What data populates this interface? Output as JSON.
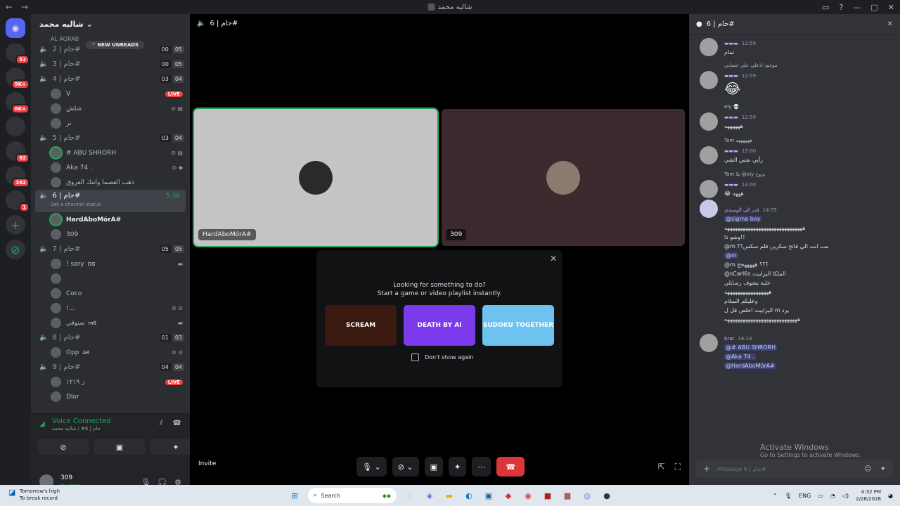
{
  "window": {
    "title": "شاليه محمد"
  },
  "rail": {
    "servers": [
      {
        "icon": "discord-home-icon",
        "badge": ""
      },
      {
        "icon": "server-icon",
        "badge": "52"
      },
      {
        "icon": "server-icon",
        "badge": "9K+"
      },
      {
        "icon": "server-icon",
        "badge": "6K+"
      },
      {
        "icon": "server-icon",
        "badge": ""
      },
      {
        "icon": "server-icon",
        "badge": "92"
      },
      {
        "icon": "server-icon",
        "badge": "382"
      },
      {
        "icon": "server-icon",
        "badge": "1"
      }
    ]
  },
  "server": {
    "name": "شاليه محمد",
    "new_unreads": "NEW UNREADS"
  },
  "channels": {
    "top_cut": "AL AQRAB",
    "c2": {
      "name": "حام | 2#",
      "n1": "00",
      "n2": "05"
    },
    "c3": {
      "name": "حام | 3#",
      "n1": "00",
      "n2": "05"
    },
    "c4": {
      "name": "حام | 4#",
      "n1": "03",
      "n2": "04"
    },
    "c4_users": [
      {
        "name": "V",
        "live": "LIVE"
      },
      {
        "name": "شلش"
      },
      {
        "name": "نر"
      }
    ],
    "c5": {
      "name": "حام | 5#",
      "n1": "03",
      "n2": "04"
    },
    "c5_users": [
      {
        "name": "# ABU SHRORH"
      },
      {
        "name": "Aka 74 ."
      },
      {
        "name": "ذهب العصما وانتك العروق"
      }
    ],
    "c6": {
      "name": "حام | 6#",
      "timer": "5:36",
      "status": "Set a channel status"
    },
    "c6_users": [
      {
        "name": "HardAboMórA#"
      },
      {
        "name": "309"
      }
    ],
    "c7": {
      "name": "حام | 7#",
      "n1": "05",
      "n2": "05"
    },
    "c7_users": [
      {
        "name": "! sary",
        "tag": "DG"
      },
      {
        "name": "."
      },
      {
        "name": "Coco"
      },
      {
        "name": "!..."
      },
      {
        "name": "سنوقي",
        "tag": "m8"
      }
    ],
    "c8": {
      "name": "حام | 8#",
      "n1": "01",
      "n2": "03"
    },
    "c8_users": [
      {
        "name": "Opp",
        "tag": "AR"
      }
    ],
    "c9": {
      "name": "حام | 9#",
      "n1": "04",
      "n2": "04"
    },
    "c9_users": [
      {
        "name": "ز ١٢١٩",
        "live": "LIVE"
      },
      {
        "name": "Dlor"
      }
    ]
  },
  "voice": {
    "connected": "Voice Connected",
    "sub": "حام | 6# / شاليه محمد"
  },
  "user": {
    "name": "309",
    "status": "In voice"
  },
  "stage": {
    "channel": "حام | 6#",
    "tile1_name": "HardAboMórA#",
    "tile2_name": "309",
    "activity_line1": "Looking for something to do?",
    "activity_line2": "Start a game or video playlist instantly.",
    "cards": [
      "SCREAM",
      "DEATH BY AI",
      "SUDOKU TOGETHER"
    ],
    "dont_show": "Don't show again",
    "invite": "Invite"
  },
  "chat": {
    "title": "حام | 6#",
    "placeholder": "Message حام | 6#",
    "messages": [
      {
        "time": "12:59",
        "text": "تمام"
      },
      {
        "reply": "موجود ادخلي علي حسابي",
        "time": "12:59",
        "emoji": "😂"
      },
      {
        "reply": "ely 💀",
        "time": "12:59",
        "text": "ههههههه"
      },
      {
        "reply": "Tom ههههههه",
        "time": "13:00",
        "text": "رأيي نفس الشي"
      },
      {
        "reply": "Tom يلا @ely بروح",
        "time": "13:00",
        "text": "😂 هههه"
      },
      {
        "name": "قدر الي الوسيدي",
        "time": "14:55",
        "lines": [
          "@sigma boy",
          "ههههههههههههههههههههههههههههههه",
          "وشو ذا!!",
          "@m مب انت الي فاتح سكرين فلم سكس؟؟",
          "@m",
          "@m ؟؟؟ هههههخخ",
          "@ꜱCarl6ꜱ الملكا اليزابيث",
          "خليه يشوف رسايلي",
          "هههههههههههههههههه",
          "وعليكم السلام",
          "اليزابيث اخلص فل ل m يرد",
          "ههههههههههههههههههههههههههههه"
        ]
      },
      {
        "name": "brat",
        "time": "16:18",
        "lines": [
          "@# ABU SHRORH",
          "@Aka 74 .",
          "@HardAboMórA#"
        ]
      }
    ]
  },
  "watermark": {
    "line1": "Activate Windows",
    "line2": "Go to Settings to activate Windows."
  },
  "taskbar": {
    "weather1": "Tomorrow's high",
    "weather2": "To break record",
    "search": "Search",
    "lang": "ENG",
    "time": "4:32 PM",
    "date": "2/28/2026"
  }
}
